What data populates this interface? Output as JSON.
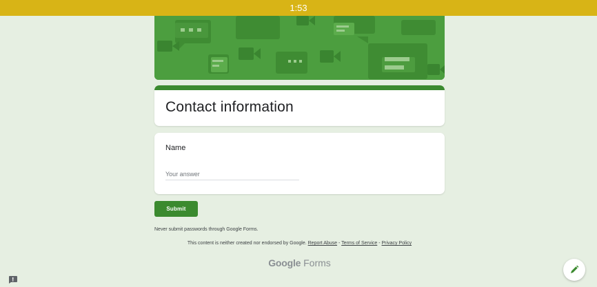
{
  "status_bar": {
    "time": "1:53"
  },
  "form": {
    "title": "Contact information",
    "questions": [
      {
        "label": "Name",
        "placeholder": "Your answer",
        "value": ""
      }
    ],
    "submit_label": "Submit"
  },
  "footer": {
    "warning": "Never submit passwords through Google Forms.",
    "disclaimer": "This content is neither created nor endorsed by Google.",
    "links": [
      "Report Abuse",
      "Terms of Service",
      "Privacy Policy"
    ],
    "separator": " - ",
    "brand_part1": "Google",
    "brand_part2": " Forms"
  },
  "icons": {
    "feedback": "feedback-icon",
    "edit": "pencil-icon",
    "banner": "chat-bubble-pattern"
  },
  "colors": {
    "status_bar": "#d8b416",
    "accent": "#3b8a2f",
    "banner": "#4c9e3f",
    "background": "#e6efe2"
  }
}
